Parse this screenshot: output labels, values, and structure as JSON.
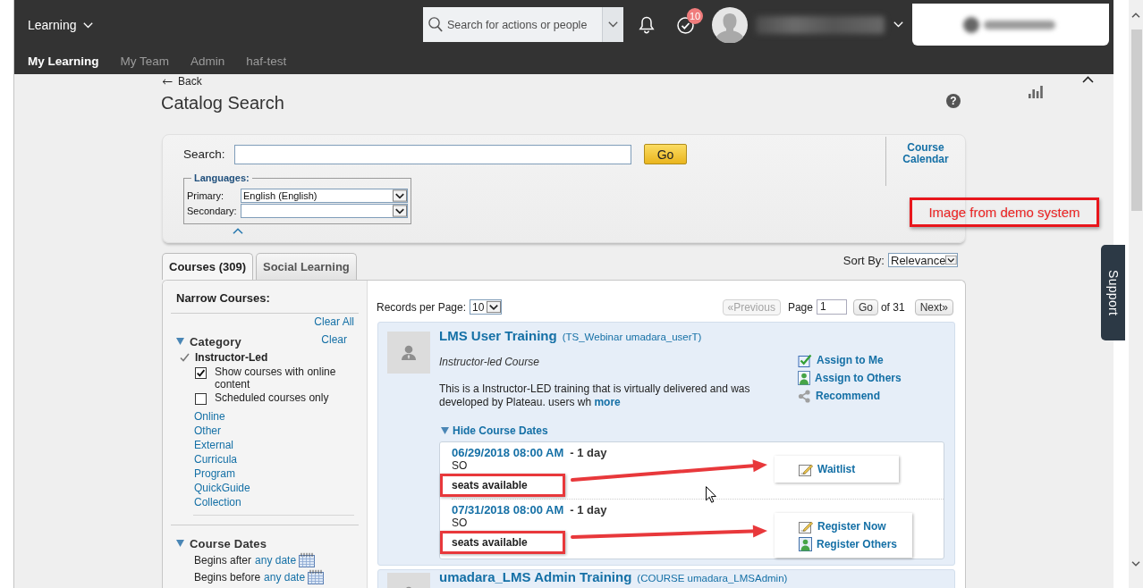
{
  "header": {
    "app_switcher": "Learning",
    "search": {
      "placeholder": "Search for actions or people"
    },
    "notification_badge": "10",
    "nav": [
      {
        "label": "My Learning",
        "selected": true
      },
      {
        "label": "My Team",
        "selected": false
      },
      {
        "label": "Admin",
        "selected": false
      },
      {
        "label": "haf-test",
        "selected": false
      }
    ]
  },
  "page": {
    "back": "Back",
    "title": "Catalog Search",
    "help": "?"
  },
  "search_panel": {
    "label": "Search:",
    "go": "Go",
    "course_calendar": "Course Calendar",
    "languages": {
      "legend": "Languages:",
      "fields": [
        {
          "label": "Primary:",
          "value": "English (English)"
        },
        {
          "label": "Secondary:"
        }
      ]
    }
  },
  "note": "Image from demo system",
  "tabs": [
    {
      "label": "Courses (309)",
      "selected": true
    },
    {
      "label": "Social Learning",
      "selected": false
    }
  ],
  "sort": {
    "label": "Sort By:",
    "value": "Relevance"
  },
  "filters": {
    "title": "Narrow Courses:",
    "clear_all": "Clear All",
    "category": {
      "title": "Category",
      "expanded": true,
      "clear": "Clear",
      "current": "Instructor-Led",
      "options": [
        {
          "label": "Show courses with online content",
          "checked": true
        },
        {
          "label": "Scheduled courses only",
          "checked": false
        }
      ],
      "links": [
        "Online",
        "Other",
        "External",
        "Curricula",
        "Program",
        "QuickGuide",
        "Collection"
      ]
    },
    "course_dates": {
      "title": "Course Dates",
      "expanded": true,
      "rows": [
        {
          "label": "Begins after",
          "link": "any date"
        },
        {
          "label": "Begins before",
          "link": "any date"
        }
      ]
    }
  },
  "results": {
    "records_label": "Records per Page:",
    "records_value": "10",
    "pagination": {
      "previous": {
        "label": "«Previous",
        "disabled": true
      },
      "page_label": "Page",
      "page_value": "1",
      "go": "Go",
      "total": "of 31",
      "next": {
        "label": "Next»",
        "disabled": false
      }
    },
    "courses": [
      {
        "title": "LMS User Training",
        "code": "(TS_Webinar umadara_userT)",
        "type": "Instructor-led Course",
        "description": "This is a Instructor-LED training that is virtually delivered and was developed by Plateau. users wh",
        "more": "more",
        "actions": [
          {
            "kind": "assign-self",
            "label": "Assign to Me"
          },
          {
            "kind": "assign-others",
            "label": "Assign to Others"
          },
          {
            "kind": "recommend",
            "label": "Recommend"
          }
        ],
        "dates_toggle": {
          "label": "Hide Course Dates",
          "expanded": true
        },
        "sessions": [
          {
            "date": "06/29/2018 08:00 AM",
            "duration": "- 1 day",
            "location": "SO",
            "seats": "seats available",
            "callout": true,
            "actions": [
              {
                "kind": "waitlist",
                "label": "Waitlist"
              }
            ]
          },
          {
            "date": "07/31/2018 08:00 AM",
            "duration": "- 1 day",
            "location": "SO",
            "seats": "seats available",
            "callout": true,
            "actions": [
              {
                "kind": "register",
                "label": "Register Now"
              },
              {
                "kind": "register-others",
                "label": "Register Others"
              }
            ]
          }
        ]
      },
      {
        "title": "umadara_LMS Admin Training",
        "code": "(COURSE umadara_LMSAdmin)"
      }
    ]
  },
  "support": "Support"
}
